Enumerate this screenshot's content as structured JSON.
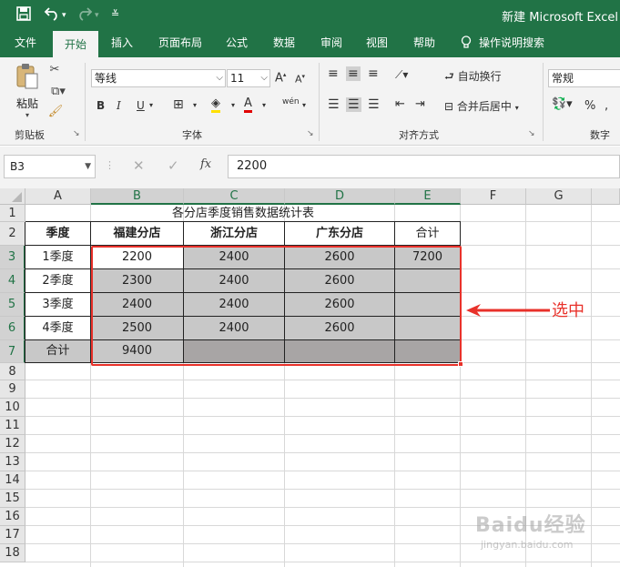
{
  "titlebar": {
    "title": "新建 Microsoft Excel",
    "save_icon": "save-icon",
    "undo_icon": "undo-icon",
    "redo_icon": "redo-icon",
    "customize_icon": "customize-qat-icon"
  },
  "tabs": [
    {
      "label": "文件"
    },
    {
      "label": "开始"
    },
    {
      "label": "插入"
    },
    {
      "label": "页面布局"
    },
    {
      "label": "公式"
    },
    {
      "label": "数据"
    },
    {
      "label": "审阅"
    },
    {
      "label": "视图"
    },
    {
      "label": "帮助"
    }
  ],
  "tellme": "操作说明搜索",
  "ribbon": {
    "clipboard": {
      "paste": "粘贴",
      "label": "剪贴板"
    },
    "font": {
      "name": "等线",
      "size": "11",
      "label": "字体",
      "bold": "B",
      "italic": "I",
      "underline": "U",
      "font_color_glyph": "A",
      "phonetic_glyph": "wén"
    },
    "alignment": {
      "wrap": "自动换行",
      "merge": "合并后居中",
      "label": "对齐方式"
    },
    "number": {
      "format": "常规",
      "label": "数字",
      "percent": "%"
    }
  },
  "formula_bar": {
    "name_box": "B3",
    "value": "2200",
    "fx": "fx"
  },
  "columns": [
    "A",
    "B",
    "C",
    "D",
    "E",
    "F",
    "G"
  ],
  "rows": [
    "1",
    "2",
    "3",
    "4",
    "5",
    "6",
    "7",
    "8",
    "9",
    "10",
    "11",
    "12",
    "13",
    "14",
    "15",
    "16",
    "17",
    "18"
  ],
  "sheet": {
    "title": "各分店季度销售数据统计表",
    "headers": [
      "季度",
      "福建分店",
      "浙江分店",
      "广东分店",
      "合计"
    ],
    "data": [
      [
        "1季度",
        "2200",
        "2400",
        "2600",
        "7200"
      ],
      [
        "2季度",
        "2300",
        "2400",
        "2600",
        ""
      ],
      [
        "3季度",
        "2400",
        "2400",
        "2600",
        ""
      ],
      [
        "4季度",
        "2500",
        "2400",
        "2600",
        ""
      ],
      [
        "合计",
        "9400",
        "",
        "",
        ""
      ]
    ]
  },
  "annotation": {
    "label": "选中",
    "color": "#e8312a"
  },
  "watermark": {
    "brand": "Baidu经验",
    "url": "jingyan.baidu.com"
  },
  "colors": {
    "excel_green": "#217346",
    "selection_gray": "#c8c8c8",
    "total_gray": "#a8a5a5"
  }
}
